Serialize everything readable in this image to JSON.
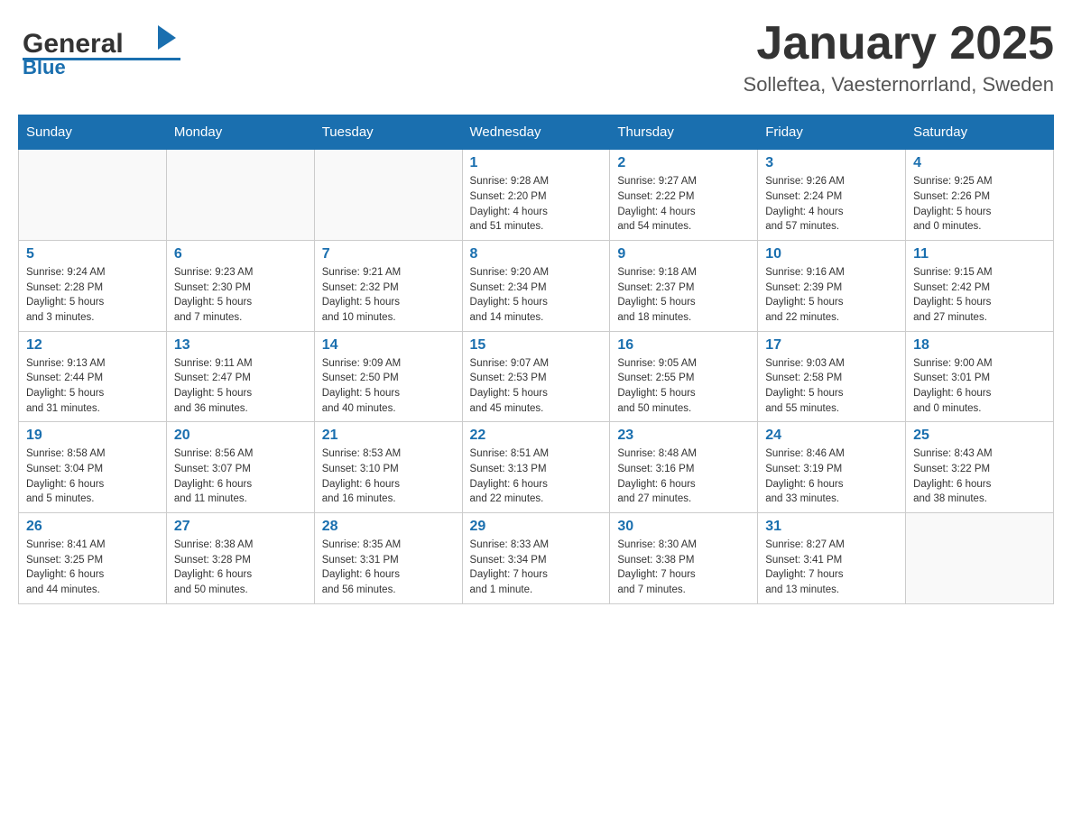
{
  "header": {
    "logo_text_black": "General",
    "logo_text_blue": "Blue",
    "title": "January 2025",
    "subtitle": "Solleftea, Vaesternorrland, Sweden"
  },
  "days_of_week": [
    "Sunday",
    "Monday",
    "Tuesday",
    "Wednesday",
    "Thursday",
    "Friday",
    "Saturday"
  ],
  "weeks": [
    {
      "days": [
        {
          "num": "",
          "info": ""
        },
        {
          "num": "",
          "info": ""
        },
        {
          "num": "",
          "info": ""
        },
        {
          "num": "1",
          "info": "Sunrise: 9:28 AM\nSunset: 2:20 PM\nDaylight: 4 hours\nand 51 minutes."
        },
        {
          "num": "2",
          "info": "Sunrise: 9:27 AM\nSunset: 2:22 PM\nDaylight: 4 hours\nand 54 minutes."
        },
        {
          "num": "3",
          "info": "Sunrise: 9:26 AM\nSunset: 2:24 PM\nDaylight: 4 hours\nand 57 minutes."
        },
        {
          "num": "4",
          "info": "Sunrise: 9:25 AM\nSunset: 2:26 PM\nDaylight: 5 hours\nand 0 minutes."
        }
      ]
    },
    {
      "days": [
        {
          "num": "5",
          "info": "Sunrise: 9:24 AM\nSunset: 2:28 PM\nDaylight: 5 hours\nand 3 minutes."
        },
        {
          "num": "6",
          "info": "Sunrise: 9:23 AM\nSunset: 2:30 PM\nDaylight: 5 hours\nand 7 minutes."
        },
        {
          "num": "7",
          "info": "Sunrise: 9:21 AM\nSunset: 2:32 PM\nDaylight: 5 hours\nand 10 minutes."
        },
        {
          "num": "8",
          "info": "Sunrise: 9:20 AM\nSunset: 2:34 PM\nDaylight: 5 hours\nand 14 minutes."
        },
        {
          "num": "9",
          "info": "Sunrise: 9:18 AM\nSunset: 2:37 PM\nDaylight: 5 hours\nand 18 minutes."
        },
        {
          "num": "10",
          "info": "Sunrise: 9:16 AM\nSunset: 2:39 PM\nDaylight: 5 hours\nand 22 minutes."
        },
        {
          "num": "11",
          "info": "Sunrise: 9:15 AM\nSunset: 2:42 PM\nDaylight: 5 hours\nand 27 minutes."
        }
      ]
    },
    {
      "days": [
        {
          "num": "12",
          "info": "Sunrise: 9:13 AM\nSunset: 2:44 PM\nDaylight: 5 hours\nand 31 minutes."
        },
        {
          "num": "13",
          "info": "Sunrise: 9:11 AM\nSunset: 2:47 PM\nDaylight: 5 hours\nand 36 minutes."
        },
        {
          "num": "14",
          "info": "Sunrise: 9:09 AM\nSunset: 2:50 PM\nDaylight: 5 hours\nand 40 minutes."
        },
        {
          "num": "15",
          "info": "Sunrise: 9:07 AM\nSunset: 2:53 PM\nDaylight: 5 hours\nand 45 minutes."
        },
        {
          "num": "16",
          "info": "Sunrise: 9:05 AM\nSunset: 2:55 PM\nDaylight: 5 hours\nand 50 minutes."
        },
        {
          "num": "17",
          "info": "Sunrise: 9:03 AM\nSunset: 2:58 PM\nDaylight: 5 hours\nand 55 minutes."
        },
        {
          "num": "18",
          "info": "Sunrise: 9:00 AM\nSunset: 3:01 PM\nDaylight: 6 hours\nand 0 minutes."
        }
      ]
    },
    {
      "days": [
        {
          "num": "19",
          "info": "Sunrise: 8:58 AM\nSunset: 3:04 PM\nDaylight: 6 hours\nand 5 minutes."
        },
        {
          "num": "20",
          "info": "Sunrise: 8:56 AM\nSunset: 3:07 PM\nDaylight: 6 hours\nand 11 minutes."
        },
        {
          "num": "21",
          "info": "Sunrise: 8:53 AM\nSunset: 3:10 PM\nDaylight: 6 hours\nand 16 minutes."
        },
        {
          "num": "22",
          "info": "Sunrise: 8:51 AM\nSunset: 3:13 PM\nDaylight: 6 hours\nand 22 minutes."
        },
        {
          "num": "23",
          "info": "Sunrise: 8:48 AM\nSunset: 3:16 PM\nDaylight: 6 hours\nand 27 minutes."
        },
        {
          "num": "24",
          "info": "Sunrise: 8:46 AM\nSunset: 3:19 PM\nDaylight: 6 hours\nand 33 minutes."
        },
        {
          "num": "25",
          "info": "Sunrise: 8:43 AM\nSunset: 3:22 PM\nDaylight: 6 hours\nand 38 minutes."
        }
      ]
    },
    {
      "days": [
        {
          "num": "26",
          "info": "Sunrise: 8:41 AM\nSunset: 3:25 PM\nDaylight: 6 hours\nand 44 minutes."
        },
        {
          "num": "27",
          "info": "Sunrise: 8:38 AM\nSunset: 3:28 PM\nDaylight: 6 hours\nand 50 minutes."
        },
        {
          "num": "28",
          "info": "Sunrise: 8:35 AM\nSunset: 3:31 PM\nDaylight: 6 hours\nand 56 minutes."
        },
        {
          "num": "29",
          "info": "Sunrise: 8:33 AM\nSunset: 3:34 PM\nDaylight: 7 hours\nand 1 minute."
        },
        {
          "num": "30",
          "info": "Sunrise: 8:30 AM\nSunset: 3:38 PM\nDaylight: 7 hours\nand 7 minutes."
        },
        {
          "num": "31",
          "info": "Sunrise: 8:27 AM\nSunset: 3:41 PM\nDaylight: 7 hours\nand 13 minutes."
        },
        {
          "num": "",
          "info": ""
        }
      ]
    }
  ]
}
